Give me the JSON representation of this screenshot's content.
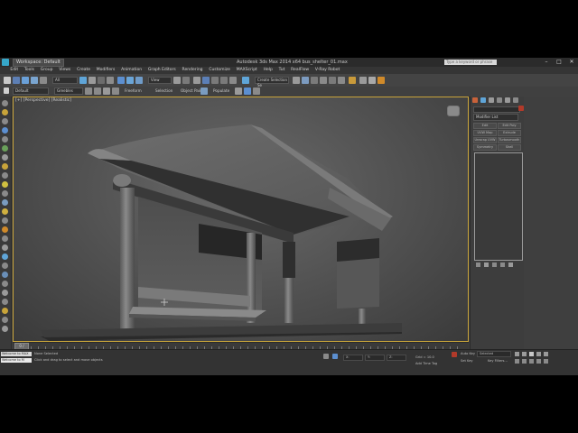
{
  "titlebar": {
    "workspace": "Workspace: Default",
    "title": "Autodesk 3ds Max 2014 x64   bus_shelter_01.max",
    "search_placeholder": "Type a keyword or phrase"
  },
  "menu": [
    "Edit",
    "Tools",
    "Group",
    "Views",
    "Create",
    "Modifiers",
    "Animation",
    "Graph Editors",
    "Rendering",
    "Customize",
    "MAXScript",
    "Help",
    "Tut",
    "RealFlow",
    "V-Ray Robot"
  ],
  "toolbar": {
    "selection_filter": "All",
    "view_dropdown": "View",
    "named_sets": "Create Selection Se",
    "object_name": "Greebles",
    "layer": "Default"
  },
  "ribbon": {
    "labels": [
      "Freeform",
      "Selection",
      "Object Paint",
      "Populate"
    ]
  },
  "viewport": {
    "label": "[+] [Perspective] [Realistic]"
  },
  "command_panel": {
    "modifier_list": "Modifier List",
    "buttons": [
      "Edit",
      "Edit Poly",
      "UVW Map",
      "Extrude",
      "Unwrap UVW",
      "Turbosmooth",
      "Symmetry",
      "Shell"
    ]
  },
  "timeline": {
    "frame": "0 / 100",
    "ticks": [
      "0",
      "5",
      "10",
      "15",
      "20",
      "25",
      "30",
      "35",
      "40",
      "45",
      "50",
      "55",
      "60",
      "65",
      "70",
      "75",
      "80",
      "85",
      "90",
      "95",
      "100"
    ]
  },
  "statusbar": {
    "maxscript_line1": "Welcome to MAX",
    "maxscript_line2": "Welcome to M",
    "status1": "None Selected",
    "status2": "Click and drag to select and move objects",
    "x": "X:",
    "y": "Y:",
    "z": "Z:",
    "grid": "Grid = 10.0",
    "autokey": "Auto Key",
    "selected": "Selected",
    "setkey": "Set Key",
    "keyfilters": "Key Filters...",
    "add_time_tag": "Add Time Tag"
  },
  "colors": {
    "viewport_border": "#c8a43a",
    "accent_blue": "#36a7c9",
    "red": "#b23a2a"
  }
}
